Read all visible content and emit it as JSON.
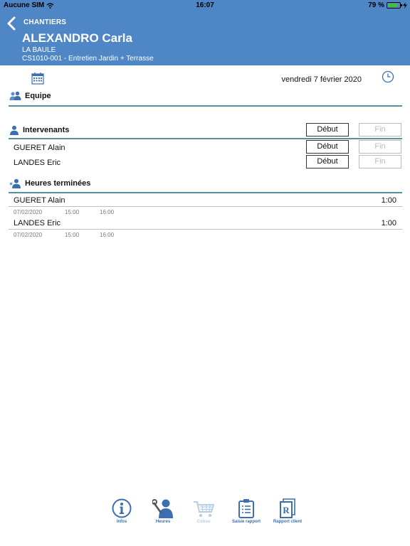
{
  "status_bar": {
    "carrier": "Aucune SIM",
    "time": "16:07",
    "battery": "79 %",
    "battery_level": 0.79
  },
  "header": {
    "back_label": "CHANTIERS",
    "title": "ALEXANDRO Carla",
    "city": "LA BAULE",
    "project": "CS1010-001 - Entretien Jardin + Terrasse"
  },
  "date": "vendredi 7 février 2020",
  "equipe": {
    "title": "Equipe"
  },
  "intervenants": {
    "title": "Intervenants",
    "start_label": "Début",
    "end_label": "Fin",
    "rows": [
      {
        "name": "GUERET Alain",
        "start_label": "Début",
        "end_label": "Fin"
      },
      {
        "name": "LANDES Eric",
        "start_label": "Début",
        "end_label": "Fin"
      }
    ]
  },
  "heures": {
    "title": "Heures terminées",
    "rows": [
      {
        "name": "GUERET Alain",
        "duration": "1:00",
        "date": "07/02/2020",
        "start": "15:00",
        "end": "16:00"
      },
      {
        "name": "LANDES Eric",
        "duration": "1:00",
        "date": "07/02/2020",
        "start": "15:00",
        "end": "16:00"
      }
    ]
  },
  "tabs": [
    {
      "label": "Infos",
      "icon": "info-icon"
    },
    {
      "label": "Heures",
      "icon": "worker-wrench-icon"
    },
    {
      "label": "Conso",
      "icon": "cart-icon"
    },
    {
      "label": "Saisie rapport",
      "icon": "clipboard-icon"
    },
    {
      "label": "Rapport client",
      "icon": "report-r-icon"
    }
  ],
  "colors": {
    "header": "#4f86c6",
    "accent_rule": "#5a8fa0",
    "tab_icon": "#3b6fb0"
  }
}
